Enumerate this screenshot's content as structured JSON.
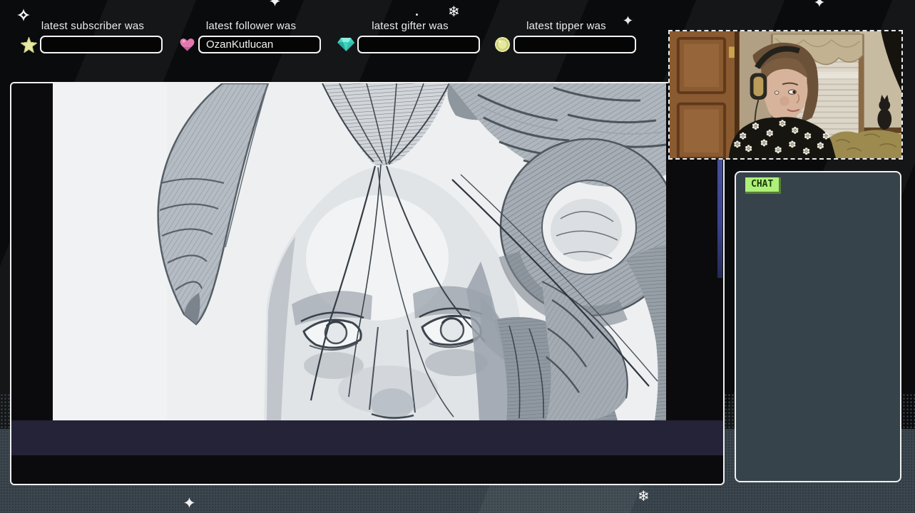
{
  "overlay": {
    "widgets": [
      {
        "label": "latest subscriber was",
        "value": "",
        "icon": "star",
        "icon_color": "#e7e9a3"
      },
      {
        "label": "latest follower was",
        "value": "OzanKutlucan",
        "icon": "heart",
        "icon_color": "#e378ae"
      },
      {
        "label": "latest gifter was",
        "value": "",
        "icon": "gem",
        "icon_color": "#3fd2c0"
      },
      {
        "label": "latest tipper was",
        "value": "",
        "icon": "coin",
        "icon_color": "#e6e89e"
      }
    ],
    "chat_panel": {
      "label": "CHAT",
      "label_bg": "#aef07a",
      "panel_bg": "#37434b"
    },
    "colors": {
      "background": "#0a0b0d",
      "bottom_band": "#3b464e",
      "frame_border": "#f0f0f0",
      "content_bar": "#242338",
      "scrollbar": "#46519c"
    },
    "decorations": [
      "sparkle-icon",
      "snowflake-icon"
    ]
  }
}
